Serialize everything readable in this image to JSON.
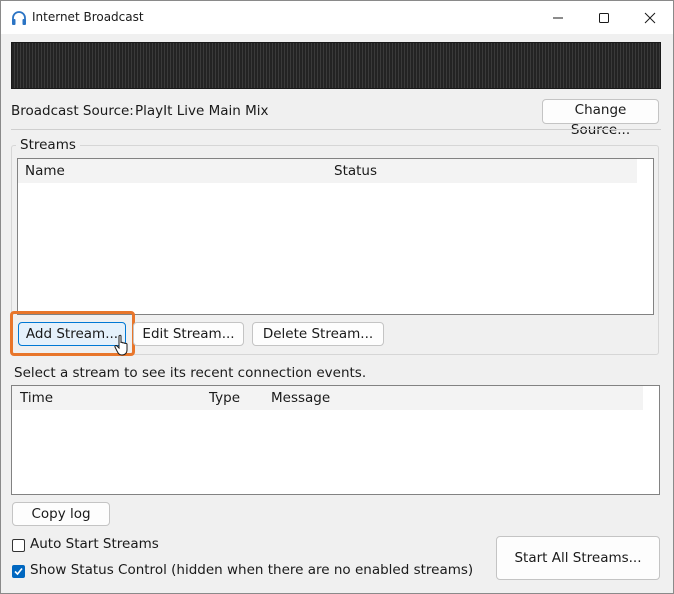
{
  "window": {
    "title": "Internet Broadcast",
    "icon": "headphones-icon"
  },
  "source": {
    "label": "Broadcast Source:",
    "value": "PlayIt Live Main Mix",
    "change_button": "Change Source..."
  },
  "streams": {
    "group_label": "Streams",
    "columns": [
      "Name",
      "Status"
    ],
    "rows": [],
    "add_button": "Add Stream...",
    "edit_button": "Edit Stream...",
    "delete_button": "Delete Stream..."
  },
  "log": {
    "hint": "Select a stream to see its recent connection events.",
    "columns": [
      "Time",
      "Type",
      "Message"
    ],
    "rows": [],
    "copy_button": "Copy log"
  },
  "options": {
    "auto_start": {
      "label": "Auto Start Streams",
      "checked": false
    },
    "show_status": {
      "label": "Show Status Control (hidden when there are no enabled streams)",
      "checked": true
    }
  },
  "start_all_button": "Start All Streams...",
  "colors": {
    "highlight": "#e8762b",
    "accent": "#0067c0",
    "meter_bg": "#232323"
  }
}
